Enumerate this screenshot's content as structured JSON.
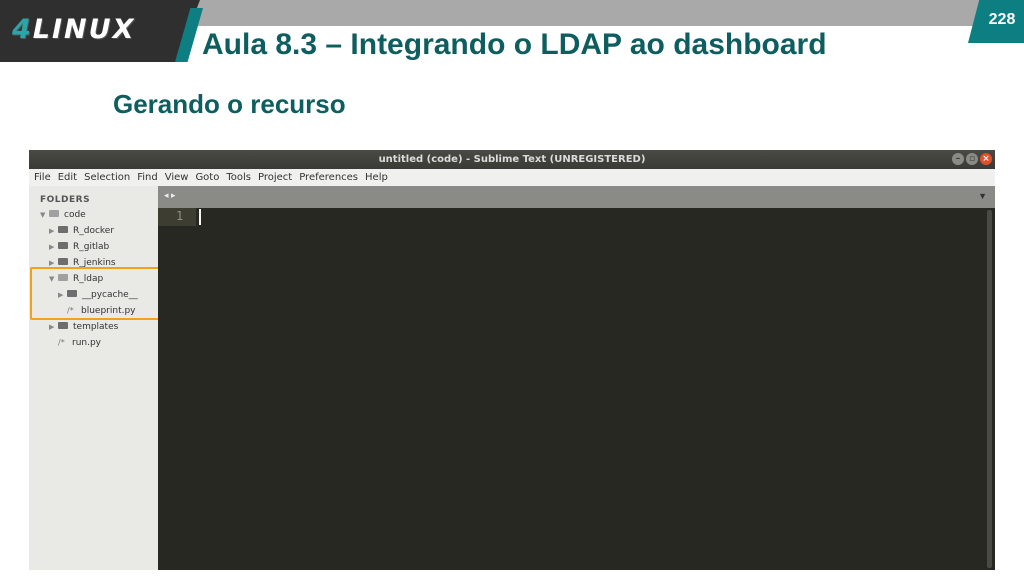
{
  "slide": {
    "logo": "4LINUX",
    "page_number": "228",
    "title": "Aula 8.3 – Integrando o LDAP ao dashboard",
    "subtitle": "Gerando o recurso",
    "accent_color": "#0d7f82",
    "title_color": "#0f5e5f"
  },
  "window": {
    "title": "untitled (code) - Sublime Text (UNREGISTERED)",
    "buttons": [
      "minimize-icon",
      "maximize-icon",
      "close-icon"
    ]
  },
  "menu": [
    "File",
    "Edit",
    "Selection",
    "Find",
    "View",
    "Goto",
    "Tools",
    "Project",
    "Preferences",
    "Help"
  ],
  "sidebar": {
    "heading": "FOLDERS",
    "items": [
      {
        "label": "code",
        "type": "folder-open"
      },
      {
        "label": "R_docker",
        "type": "folder"
      },
      {
        "label": "R_gitlab",
        "type": "folder"
      },
      {
        "label": "R_jenkins",
        "type": "folder"
      },
      {
        "label": "R_ldap",
        "type": "folder-open"
      },
      {
        "label": "__pycache__",
        "type": "folder"
      },
      {
        "label": "blueprint.py",
        "type": "file"
      },
      {
        "label": "templates",
        "type": "folder"
      },
      {
        "label": "run.py",
        "type": "file"
      }
    ],
    "highlight_color": "#f0a21a"
  },
  "tabbar": {
    "arrows": "◂ ▸",
    "dropdown": "▼"
  },
  "editor": {
    "line_numbers": [
      "1"
    ]
  }
}
